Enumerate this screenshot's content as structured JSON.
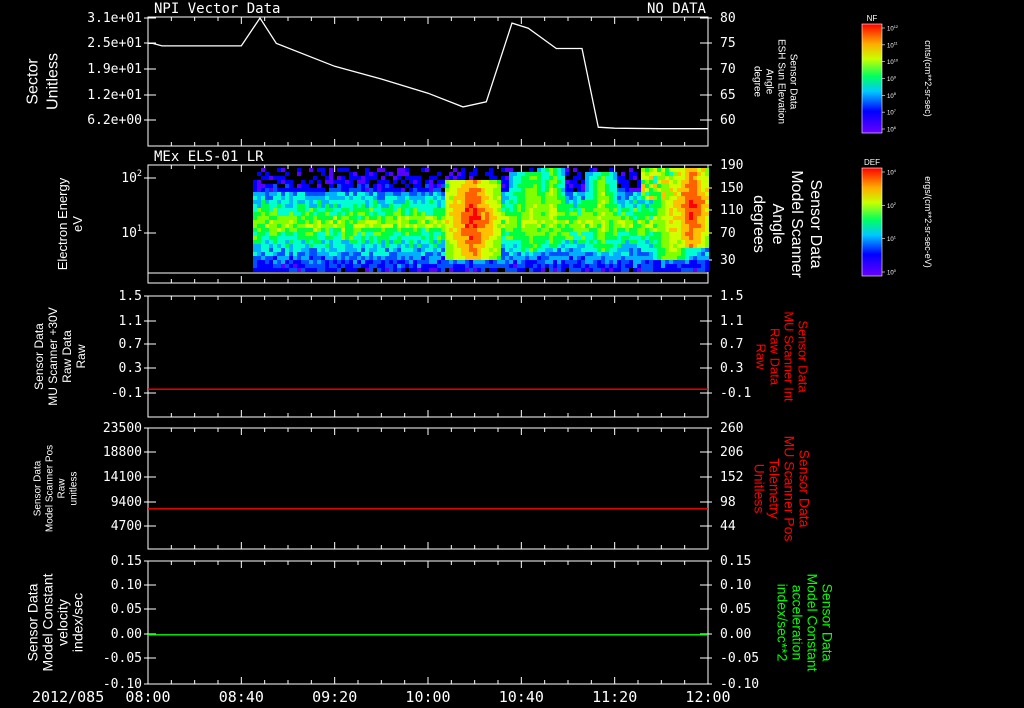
{
  "colors": {
    "background": "#000000",
    "axis": "#ffffff",
    "red": "#ff0000",
    "green": "#00ff00"
  },
  "time_axis": {
    "date_label": "2012/085",
    "ticks": [
      "08:00",
      "08:40",
      "09:20",
      "10:00",
      "10:40",
      "11:20",
      "12:00"
    ]
  },
  "chart_data": [
    {
      "type": "line",
      "title": "NPI Vector Data",
      "status": "NO DATA",
      "ylabel_left": [
        "Sector",
        "Unitless"
      ],
      "left_ticks": [
        "3.1e+01",
        "2.5e+01",
        "1.9e+01",
        "1.2e+01",
        "6.2e+00"
      ],
      "ylabel_right": [
        "Sensor Data",
        "ESH Sun Elevation",
        "Angle",
        "degree"
      ],
      "right_ticks": [
        "80",
        "75",
        "70",
        "65",
        "60"
      ],
      "ylim_right": [
        55,
        80
      ],
      "series": [
        {
          "x": [
            "08:00",
            "08:02",
            "08:06",
            "08:12",
            "08:25",
            "08:40",
            "08:48",
            "08:55",
            "09:20",
            "09:40",
            "10:00",
            "10:15",
            "10:25",
            "10:36",
            "10:43",
            "10:55",
            "11:06",
            "11:13",
            "11:20",
            "11:40",
            "12:00"
          ],
          "y": [
            75,
            75,
            74.5,
            74.5,
            74.5,
            74.5,
            80,
            75,
            70.5,
            68,
            65.2,
            62.5,
            63.5,
            79,
            78,
            74,
            74,
            58.5,
            58.3,
            58.2,
            58.2
          ]
        }
      ]
    },
    {
      "type": "heatmap",
      "title": "MEx ELS-01 LR",
      "ylabel_left": [
        "Electron Energy",
        "eV"
      ],
      "left_ticks": [
        "10^2",
        "10^1"
      ],
      "ylabel_right": [
        "Sensor Data",
        "Model Scanner",
        "Angle",
        "degrees"
      ],
      "right_ticks": [
        "190",
        "150",
        "110",
        "70",
        "30"
      ],
      "data_start": "08:45",
      "colorbar": {
        "label": "DEF",
        "unit": "ergs/(cm**2-sr-sec-eV)",
        "ticks": [
          "10^4",
          "10^2",
          "10^1",
          "10^0"
        ]
      }
    },
    {
      "type": "line",
      "ylabel_left": [
        "Sensor Data",
        "MU Scanner +30V",
        "Raw Data",
        "Raw"
      ],
      "left_ticks": [
        "1.5",
        "1.1",
        "0.7",
        "0.3",
        "-0.1"
      ],
      "ylabel_right": [
        "Sensor Data",
        "MU Scanner Int",
        "Raw Data",
        "Raw"
      ],
      "right_ticks": [
        "1.5",
        "1.1",
        "0.7",
        "0.3",
        "-0.1"
      ],
      "ylim": [
        -0.5,
        1.5
      ],
      "series": [
        {
          "color": "#ff0000",
          "x": [
            "08:00",
            "12:00"
          ],
          "y": [
            -0.04,
            -0.04
          ]
        }
      ]
    },
    {
      "type": "line",
      "ylabel_left": [
        "Sensor Data",
        "Model Scanner Pos",
        "Raw",
        "unitless"
      ],
      "left_ticks": [
        "23500",
        "18800",
        "14100",
        "9400",
        "4700"
      ],
      "ylabel_right": [
        "Sensor Data",
        "MU Scanner Pos",
        "Telemetry",
        "Unitless"
      ],
      "right_ticks": [
        "260",
        "206",
        "152",
        "98",
        "44"
      ],
      "ylim": [
        0,
        23500
      ],
      "series": [
        {
          "color": "#ff0000",
          "x": [
            "08:00",
            "12:00"
          ],
          "y": [
            7800,
            7800
          ]
        }
      ]
    },
    {
      "type": "line",
      "ylabel_left": [
        "Sensor Data",
        "Model Constant",
        "velocity",
        "index/sec"
      ],
      "left_ticks": [
        "0.15",
        "0.10",
        "0.05",
        "0.00",
        "-0.05",
        "-0.10"
      ],
      "ylabel_right": [
        "Sensor Data",
        "Model Constant",
        "acceleration",
        "index/sec**2"
      ],
      "right_ticks": [
        "0.15",
        "0.10",
        "0.05",
        "0.00",
        "-0.05",
        "-0.10"
      ],
      "ylim": [
        -0.1,
        0.15
      ],
      "series": [
        {
          "color": "#00ff00",
          "x": [
            "08:00",
            "12:00"
          ],
          "y": [
            0,
            0
          ]
        }
      ]
    }
  ],
  "top_colorbar": {
    "label": "NF",
    "unit": "cnts/(cm**2-sr-sec)",
    "ticks": [
      "10^12",
      "10^11",
      "10^10",
      "10^9",
      "10^8",
      "10^7",
      "10^6"
    ]
  }
}
